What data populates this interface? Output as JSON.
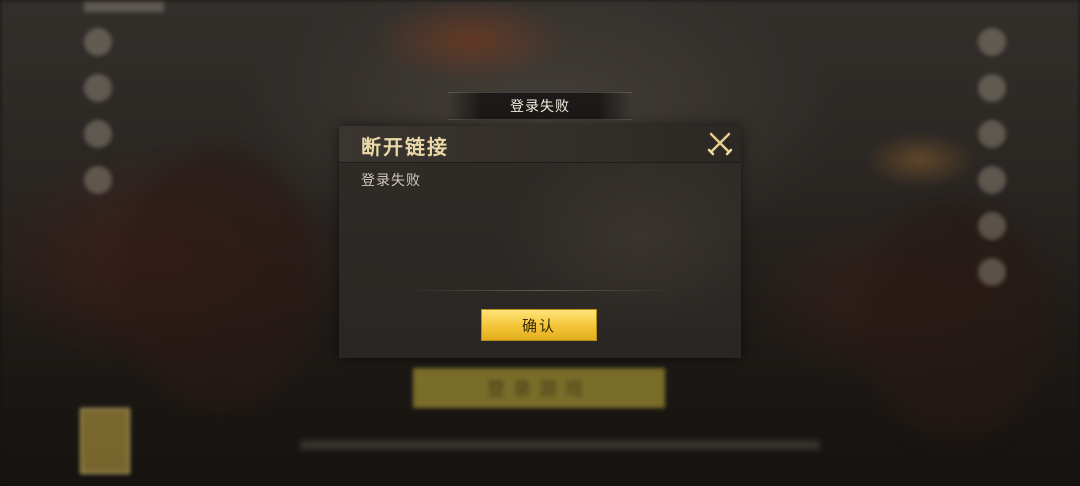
{
  "background": {
    "start_button_label": "登录游戏"
  },
  "dialog": {
    "banner_title": "登录失败",
    "header_title": "断开链接",
    "message": "登录失败",
    "confirm_label": "确认",
    "close_icon": "close-icon-crossed-swords"
  },
  "colors": {
    "header_title": "#ead9a8",
    "confirm_button": "#f3c536",
    "dialog_bg": "#2c2824"
  }
}
